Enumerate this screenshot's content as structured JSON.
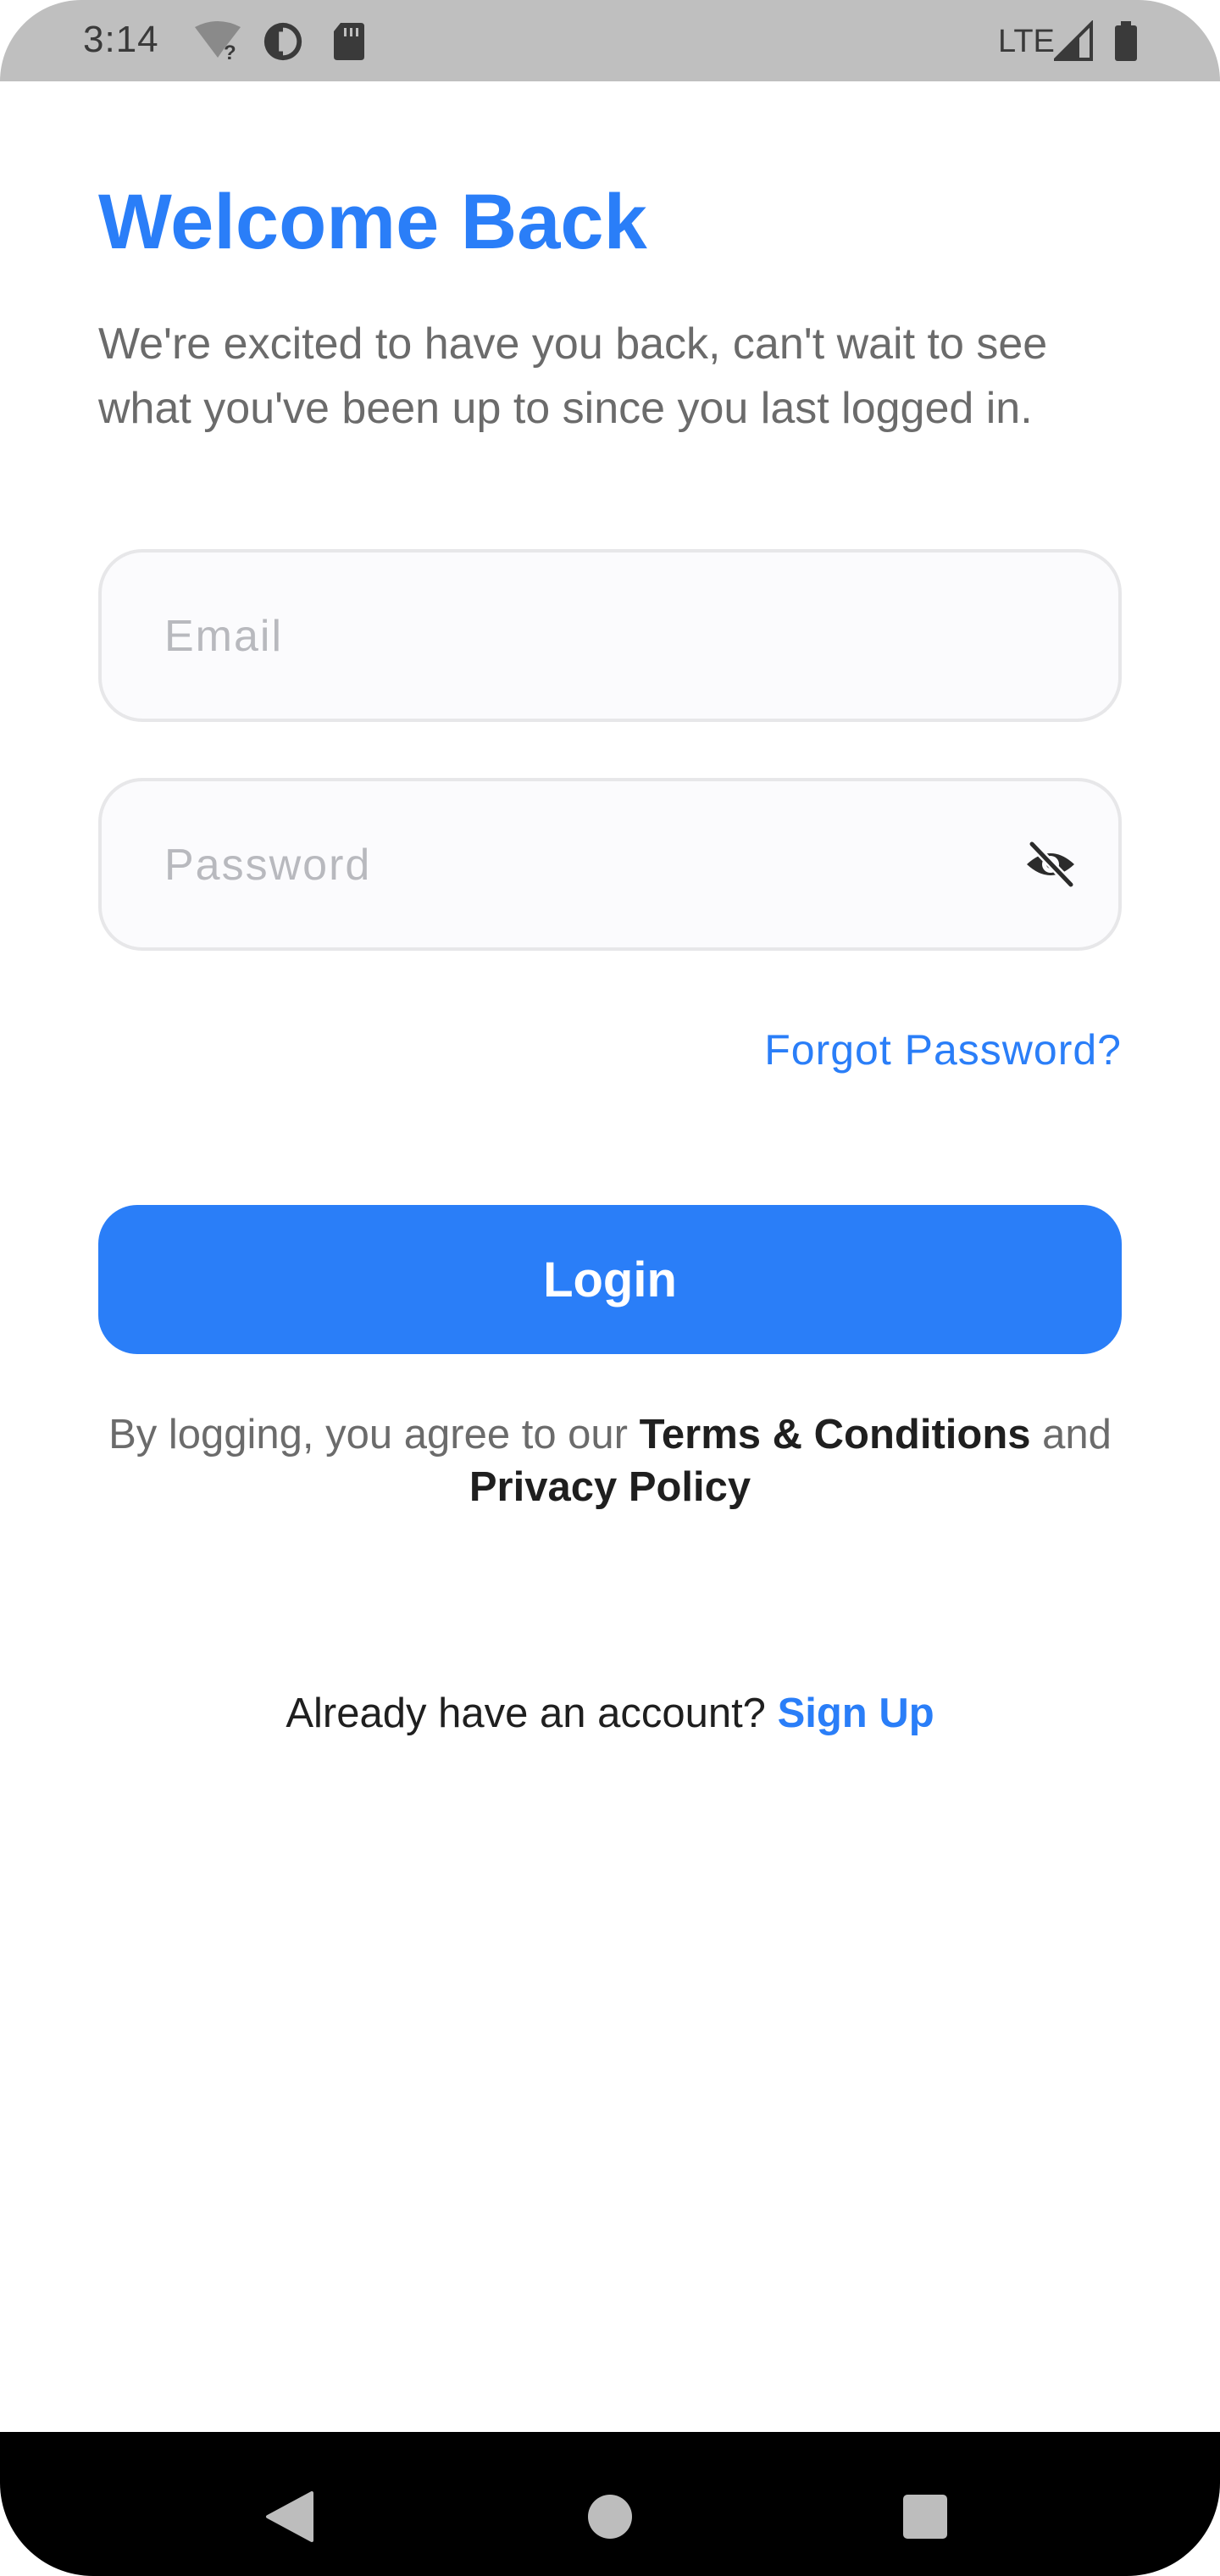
{
  "status_bar": {
    "time": "3:14",
    "network": "LTE",
    "icons": [
      "wifi-unknown-icon",
      "data-saver-icon",
      "sd-card-icon",
      "signal-icon",
      "battery-icon"
    ]
  },
  "login": {
    "title": "Welcome Back",
    "subtitle": "We're excited to have you back, can't wait to see what you've been up to since you last logged in.",
    "email_placeholder": "Email",
    "password_placeholder": "Password",
    "forgot_password": "Forgot Password?",
    "login_button": "Login",
    "terms_prefix": "By logging, you agree to our ",
    "terms_link": "Terms & Conditions",
    "terms_and": " and",
    "privacy_link": "Privacy Policy",
    "signup_prompt": "Already have an account? ",
    "signup_link": "Sign Up"
  },
  "nav_bar": {
    "buttons": [
      "back-icon",
      "home-icon",
      "recents-icon"
    ]
  },
  "colors": {
    "accent": "#2a7ef8",
    "status_bar": "#bfbfbf",
    "field_border": "#e7e7e9",
    "field_bg": "#fbfbfd",
    "placeholder": "#b8b9be",
    "body_text": "#6b6b6b",
    "dark_text": "#1f1f1f"
  }
}
